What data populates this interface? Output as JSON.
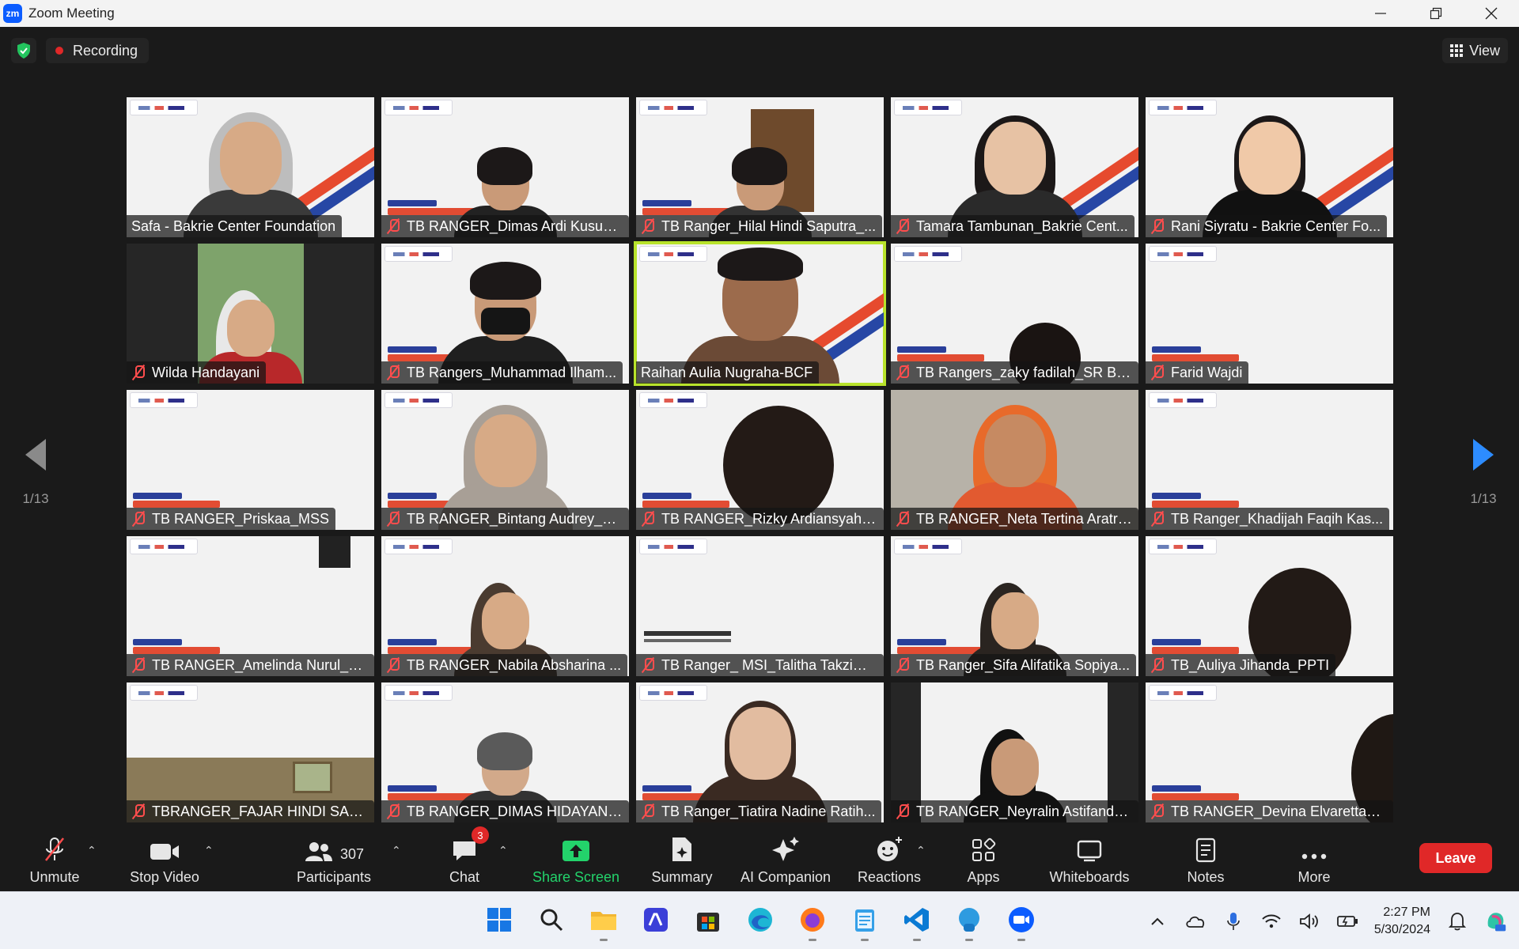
{
  "window": {
    "app_logo": "zm",
    "title": "Zoom Meeting"
  },
  "topbar": {
    "recording_label": "Recording",
    "view_label": "View"
  },
  "pagination": {
    "left": "1/13",
    "right": "1/13"
  },
  "tiles": [
    "Safa - Bakrie Center Foundation",
    "TB RANGER_Dimas Ardi Kusum...",
    "TB Ranger_Hilal Hindi Saputra_...",
    "Tamara Tambunan_Bakrie Cent...",
    "Rani Siyratu - Bakrie Center Fo...",
    "Wilda Handayani",
    "TB Rangers_Muhammad Ilham...",
    "Raihan Aulia Nugraha-BCF",
    "TB Rangers_zaky fadilah_SR Ba...",
    "Farid Wajdi",
    "TB RANGER_Priskaa_MSS",
    "TB RANGER_Bintang Audrey_M...",
    "TB RANGER_Rizky Ardiansyah_...",
    "TB RANGER_Neta Tertina Aratri...",
    "TB Ranger_Khadijah Faqih Kas...",
    "TB RANGER_Amelinda Nurul_S...",
    "TB RANGER_Nabila Absharina ...",
    "TB Ranger_ MSI_Talitha Takzim ...",
    "TB Ranger_Sifa Alifatika Sopiya...",
    "TB_Auliya Jihanda_PPTI",
    "TBRANGER_FAJAR HINDI SAPU...",
    "TB RANGER_DIMAS HIDAYANT...",
    "TB Ranger_Tiatira Nadine Ratih...",
    "TB RANGER_Neyralin Astifanda...",
    "TB RANGER_Devina Elvaretta_ILS"
  ],
  "toolbar": {
    "unmute": "Unmute",
    "stop_video": "Stop Video",
    "participants": "Participants",
    "participants_count": "307",
    "chat": "Chat",
    "chat_badge": "3",
    "share_screen": "Share Screen",
    "summary": "Summary",
    "ai_companion": "AI Companion",
    "reactions": "Reactions",
    "apps": "Apps",
    "whiteboards": "Whiteboards",
    "notes": "Notes",
    "more": "More",
    "leave": "Leave"
  },
  "taskbar": {
    "time": "2:27 PM",
    "date": "5/30/2024"
  },
  "colors": {
    "accent_blue": "#2d8cff",
    "leave_red": "#e02828",
    "share_green": "#23d36b",
    "active_speaker": "#b8e32b"
  }
}
